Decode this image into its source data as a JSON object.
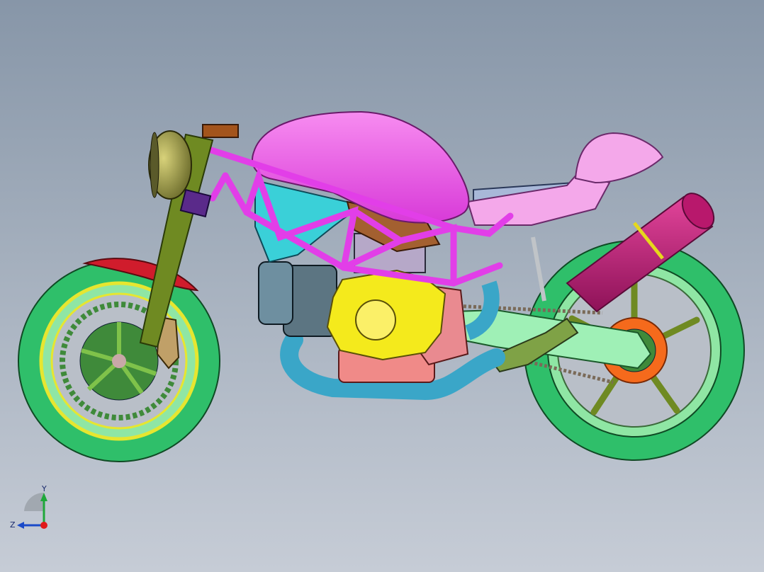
{
  "viewport": {
    "colors": {
      "background_top": "#8796a8",
      "background_bottom": "#c6ccd6",
      "frame": "#e23ee8",
      "tank": "#ee55e6",
      "wheels": "#2fbf6a",
      "rim_accent": "#e6e630",
      "engine_cover": "#f4ea1c",
      "exhaust": "#c21b7a",
      "headers": "#3aa6c8",
      "fender": "#d01c2c",
      "sprocket": "#f56a1c",
      "fork": "#6f8a22"
    }
  },
  "triad": {
    "y_label": "Y",
    "z_label": "Z"
  }
}
